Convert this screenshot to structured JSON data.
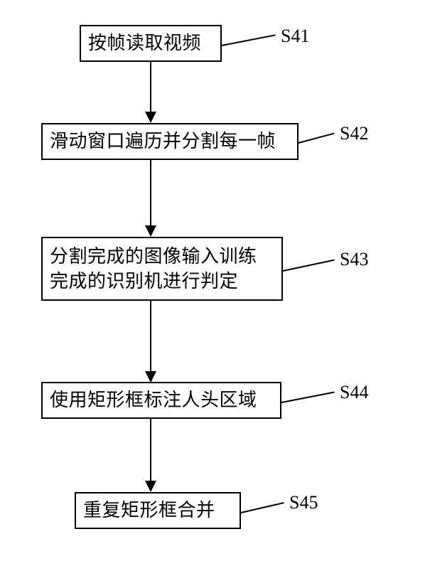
{
  "chart_data": {
    "type": "flowchart",
    "direction": "top-to-bottom",
    "nodes": [
      {
        "id": "S41",
        "label": "S41",
        "text": "按帧读取视频"
      },
      {
        "id": "S42",
        "label": "S42",
        "text": "滑动窗口遍历并分割每一帧"
      },
      {
        "id": "S43",
        "label": "S43",
        "text": "分割完成的图像输入训练完成的识别机进行判定"
      },
      {
        "id": "S44",
        "label": "S44",
        "text": "使用矩形框标注人头区域"
      },
      {
        "id": "S45",
        "label": "S45",
        "text": "重复矩形框合并"
      }
    ],
    "edges": [
      {
        "from": "S41",
        "to": "S42"
      },
      {
        "from": "S42",
        "to": "S43"
      },
      {
        "from": "S43",
        "to": "S44"
      },
      {
        "from": "S44",
        "to": "S45"
      }
    ]
  }
}
